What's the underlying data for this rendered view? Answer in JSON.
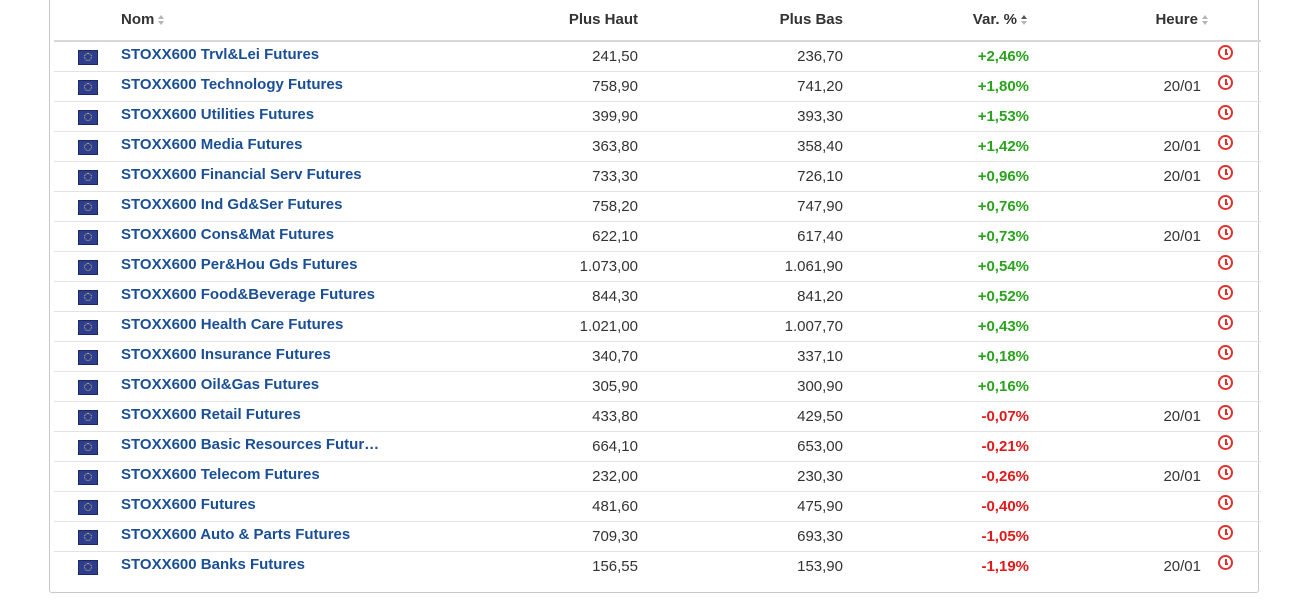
{
  "table": {
    "columns": {
      "name": "Nom",
      "high": "Plus Haut",
      "low": "Plus Bas",
      "change": "Var. %",
      "time": "Heure"
    },
    "rows": [
      {
        "name": "STOXX600 Trvl&Lei Futures",
        "high": "241,50",
        "low": "236,70",
        "change": "+2,46%",
        "time": "",
        "trend": "pos"
      },
      {
        "name": "STOXX600 Technology Futures",
        "high": "758,90",
        "low": "741,20",
        "change": "+1,80%",
        "time": "20/01",
        "trend": "pos"
      },
      {
        "name": "STOXX600 Utilities Futures",
        "high": "399,90",
        "low": "393,30",
        "change": "+1,53%",
        "time": "",
        "trend": "pos"
      },
      {
        "name": "STOXX600 Media Futures",
        "high": "363,80",
        "low": "358,40",
        "change": "+1,42%",
        "time": "20/01",
        "trend": "pos"
      },
      {
        "name": "STOXX600 Financial Serv Futures",
        "high": "733,30",
        "low": "726,10",
        "change": "+0,96%",
        "time": "20/01",
        "trend": "pos"
      },
      {
        "name": "STOXX600 Ind Gd&Ser Futures",
        "high": "758,20",
        "low": "747,90",
        "change": "+0,76%",
        "time": "",
        "trend": "pos"
      },
      {
        "name": "STOXX600 Cons&Mat Futures",
        "high": "622,10",
        "low": "617,40",
        "change": "+0,73%",
        "time": "20/01",
        "trend": "pos"
      },
      {
        "name": "STOXX600 Per&Hou Gds Futures",
        "high": "1.073,00",
        "low": "1.061,90",
        "change": "+0,54%",
        "time": "",
        "trend": "pos"
      },
      {
        "name": "STOXX600 Food&Beverage Futures",
        "high": "844,30",
        "low": "841,20",
        "change": "+0,52%",
        "time": "",
        "trend": "pos"
      },
      {
        "name": "STOXX600 Health Care Futures",
        "high": "1.021,00",
        "low": "1.007,70",
        "change": "+0,43%",
        "time": "",
        "trend": "pos"
      },
      {
        "name": "STOXX600 Insurance Futures",
        "high": "340,70",
        "low": "337,10",
        "change": "+0,18%",
        "time": "",
        "trend": "pos"
      },
      {
        "name": "STOXX600 Oil&Gas Futures",
        "high": "305,90",
        "low": "300,90",
        "change": "+0,16%",
        "time": "",
        "trend": "pos"
      },
      {
        "name": "STOXX600 Retail Futures",
        "high": "433,80",
        "low": "429,50",
        "change": "-0,07%",
        "time": "20/01",
        "trend": "neg"
      },
      {
        "name": "STOXX600 Basic Resources Futur…",
        "high": "664,10",
        "low": "653,00",
        "change": "-0,21%",
        "time": "",
        "trend": "neg"
      },
      {
        "name": "STOXX600 Telecom Futures",
        "high": "232,00",
        "low": "230,30",
        "change": "-0,26%",
        "time": "20/01",
        "trend": "neg"
      },
      {
        "name": "STOXX600 Futures",
        "high": "481,60",
        "low": "475,90",
        "change": "-0,40%",
        "time": "",
        "trend": "neg"
      },
      {
        "name": "STOXX600 Auto & Parts Futures",
        "high": "709,30",
        "low": "693,30",
        "change": "-1,05%",
        "time": "",
        "trend": "neg"
      },
      {
        "name": "STOXX600 Banks Futures",
        "high": "156,55",
        "low": "153,90",
        "change": "-1,19%",
        "time": "20/01",
        "trend": "neg"
      }
    ]
  },
  "icons": {
    "flag": "eu-flag-icon",
    "clock": "clock-icon",
    "sort": "sort-icon"
  },
  "colors": {
    "link": "#1a4f96",
    "positive": "#2aa31d",
    "negative": "#e01a1a",
    "clock": "#e0322d"
  }
}
